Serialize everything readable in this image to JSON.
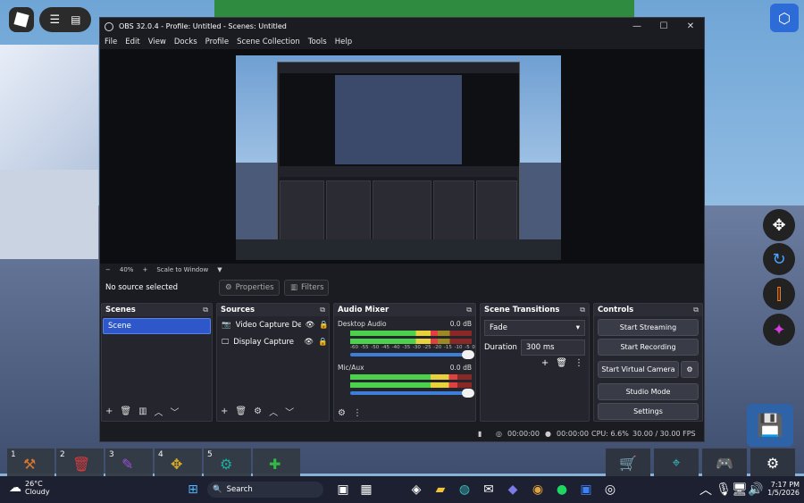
{
  "obs": {
    "title": "OBS 32.0.4 - Profile: Untitled - Scenes: Untitled",
    "menu": [
      "File",
      "Edit",
      "View",
      "Docks",
      "Profile",
      "Scene Collection",
      "Tools",
      "Help"
    ],
    "zoom": {
      "minus": "−",
      "value": "40%",
      "plus": "+",
      "mode": "Scale to Window"
    },
    "no_source": "No source selected",
    "properties": "Properties",
    "filters": "Filters",
    "scenes": {
      "title": "Scenes",
      "items": [
        "Scene"
      ]
    },
    "sources": {
      "title": "Sources",
      "items": [
        "Video Capture Dev",
        "Display Capture"
      ]
    },
    "mixer": {
      "title": "Audio Mixer",
      "channels": [
        {
          "name": "Desktop Audio",
          "db": "0.0 dB",
          "level": 0.72
        },
        {
          "name": "Mic/Aux",
          "db": "0.0 dB",
          "level": 0.88
        }
      ],
      "ticks": [
        "-60",
        "-55",
        "-50",
        "-45",
        "-40",
        "-35",
        "-30",
        "-25",
        "-20",
        "-15",
        "-10",
        "-5",
        "0"
      ]
    },
    "transitions": {
      "title": "Scene Transitions",
      "type": "Fade",
      "duration_label": "Duration",
      "duration": "300 ms"
    },
    "controls": {
      "title": "Controls",
      "buttons": [
        "Start Streaming",
        "Start Recording",
        "Start Virtual Camera",
        "Studio Mode",
        "Settings"
      ]
    },
    "status": {
      "stream_time": "00:00:00",
      "rec_time": "00:00:00",
      "cpu": "CPU: 6.6%",
      "fps": "30.00 / 30.00 FPS"
    }
  },
  "hotbar": [
    {
      "num": "1",
      "icon": "hammer-icon"
    },
    {
      "num": "2",
      "icon": "trash-icon"
    },
    {
      "num": "3",
      "icon": "pencil-icon"
    },
    {
      "num": "4",
      "icon": "move-icon"
    },
    {
      "num": "5",
      "icon": "tool-icon"
    },
    {
      "num": "",
      "icon": "tool-icon"
    }
  ],
  "taskbar": {
    "weather_temp": "26°C",
    "weather_desc": "Cloudy",
    "search": "Search",
    "time": "7:17 PM",
    "date": "1/5/2026"
  }
}
